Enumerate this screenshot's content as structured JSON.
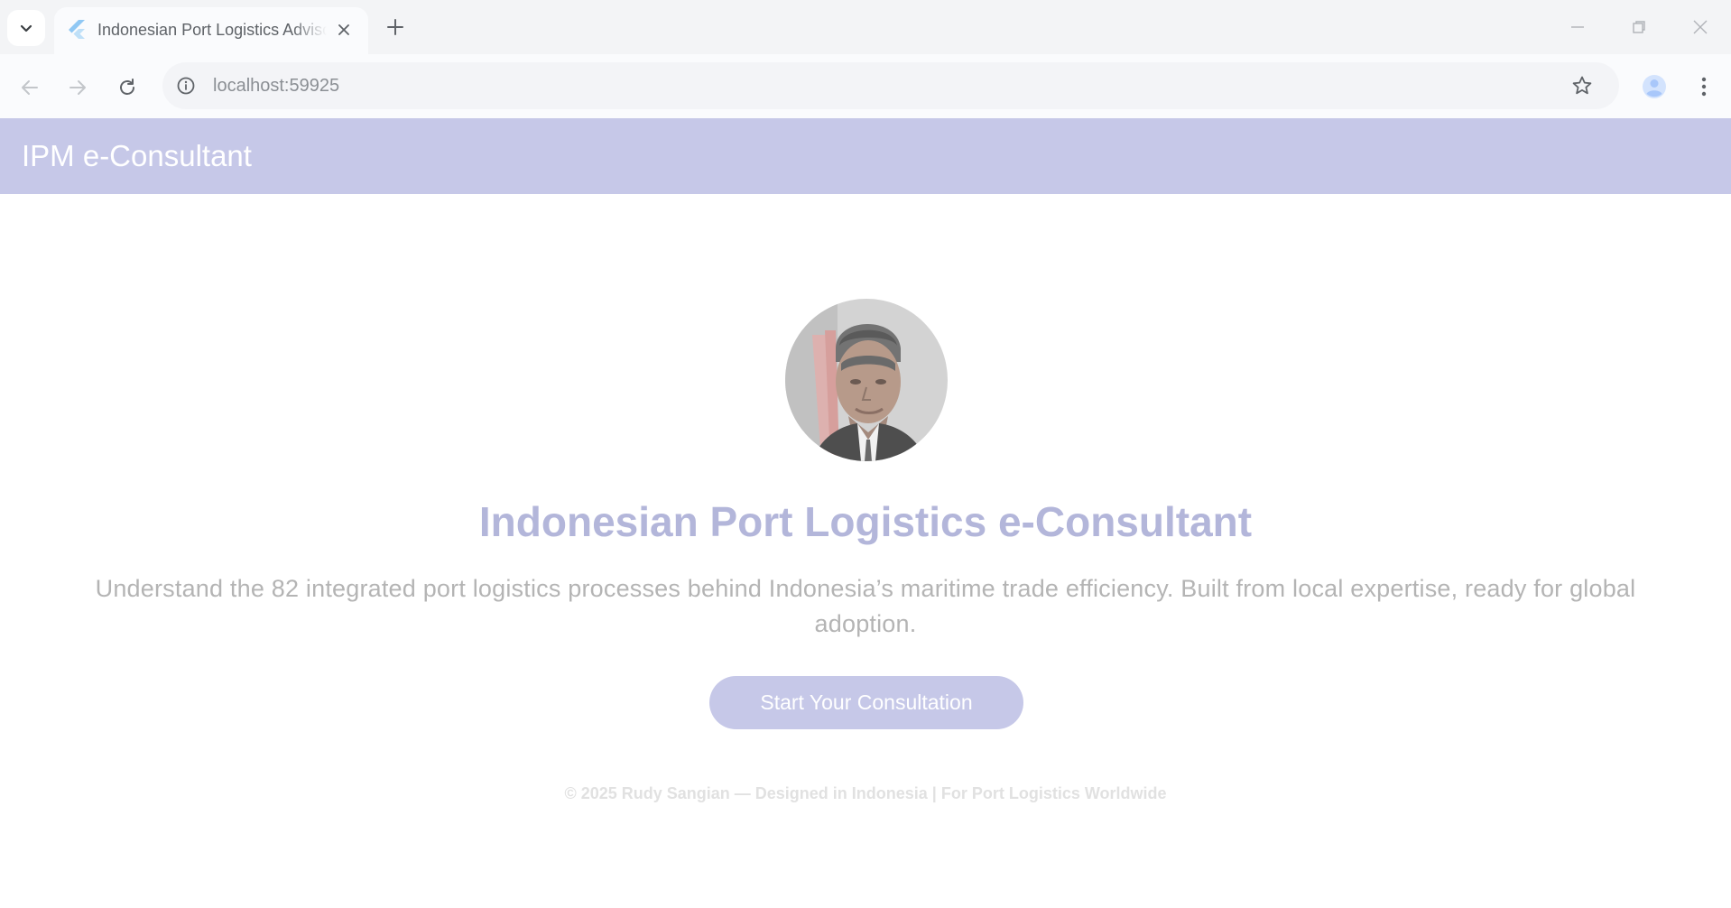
{
  "browser": {
    "tab": {
      "title": "Indonesian Port Logistics Advisor",
      "favicon": "flutter-icon"
    },
    "address_bar": {
      "url": "localhost:59925"
    },
    "icons": {
      "tab_search": "chevron-down-icon",
      "tab_close": "close-icon",
      "new_tab": "plus-icon",
      "back": "back-arrow-icon",
      "forward": "forward-arrow-icon",
      "reload": "reload-icon",
      "site_info": "info-icon",
      "bookmark": "star-icon",
      "profile": "person-icon",
      "menu": "kebab-menu-icon",
      "minimize": "minimize-icon",
      "maximize": "restore-icon",
      "close_window": "close-icon"
    }
  },
  "app_bar": {
    "title": "IPM e-Consultant"
  },
  "hero": {
    "title": "Indonesian Port Logistics e-Consultant",
    "description": "Understand the 82 integrated port logistics processes behind Indonesia’s maritime trade efficiency. Built from local expertise, ready for global adoption.",
    "cta_label": "Start Your Consultation"
  },
  "footer": {
    "text": "© 2025 Rudy Sangian — Designed in Indonesia | For Port Logistics Worldwide"
  },
  "colors": {
    "app_bar": "#c6c8e8",
    "hero_title": "#b3b6da",
    "description": "#b4b4b4",
    "button": "#c6c8e8",
    "footer": "#e1e1e1"
  }
}
